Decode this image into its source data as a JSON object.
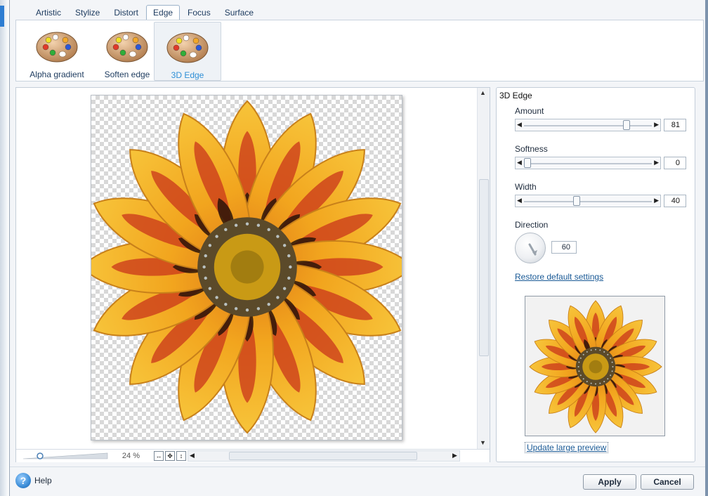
{
  "tabs": [
    {
      "label": "Artistic"
    },
    {
      "label": "Stylize"
    },
    {
      "label": "Distort"
    },
    {
      "label": "Edge",
      "active": true
    },
    {
      "label": "Focus"
    },
    {
      "label": "Surface"
    }
  ],
  "effects": [
    {
      "label": "Alpha gradient",
      "icon": "palette-icon"
    },
    {
      "label": "Soften edge",
      "icon": "palette-icon"
    },
    {
      "label": "3D Edge",
      "icon": "palette-icon",
      "selected": true
    }
  ],
  "preview": {
    "zoom_label": "24 %"
  },
  "settings": {
    "title": "3D Edge",
    "amount": {
      "label": "Amount",
      "value": "81",
      "min": 0,
      "max": 100
    },
    "softness": {
      "label": "Softness",
      "value": "0",
      "min": 0,
      "max": 100
    },
    "width": {
      "label": "Width",
      "value": "40",
      "min": 0,
      "max": 100
    },
    "direction": {
      "label": "Direction",
      "value": "60"
    },
    "restore_link": "Restore default settings",
    "update_link": "Update large preview"
  },
  "footer": {
    "help_label": "Help",
    "apply_label": "Apply",
    "cancel_label": "Cancel"
  },
  "colors": {
    "accent": "#2f8fd6",
    "link": "#1a5a96",
    "petal_outer": "#f2a51e",
    "petal_inner": "#c9361b",
    "center": "#c99a15"
  }
}
